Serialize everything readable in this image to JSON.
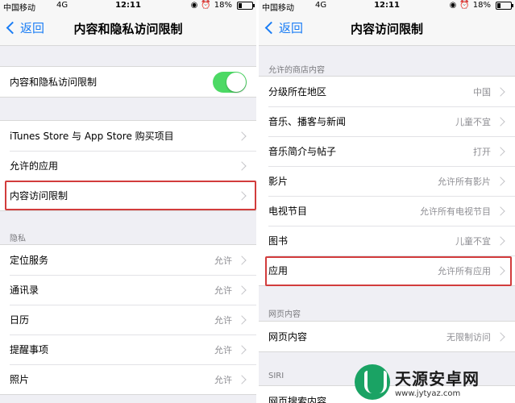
{
  "left": {
    "status": {
      "carrier": "中国移动",
      "network": "4G",
      "time": "12:11",
      "battery": "18%"
    },
    "nav": {
      "back": "返回",
      "title": "内容和隐私访问限制"
    },
    "toggle_row": {
      "label": "内容和隐私访问限制",
      "on": true
    },
    "group1": [
      {
        "label": "iTunes Store 与 App Store 购买项目",
        "value": ""
      },
      {
        "label": "允许的应用",
        "value": ""
      },
      {
        "label": "内容访问限制",
        "value": ""
      }
    ],
    "privacy_header": "隐私",
    "privacy": [
      {
        "label": "定位服务",
        "value": "允许"
      },
      {
        "label": "通讯录",
        "value": "允许"
      },
      {
        "label": "日历",
        "value": "允许"
      },
      {
        "label": "提醒事项",
        "value": "允许"
      },
      {
        "label": "照片",
        "value": "允许"
      }
    ]
  },
  "right": {
    "status": {
      "carrier": "中国移动",
      "network": "4G",
      "time": "12:11",
      "battery": "18%"
    },
    "nav": {
      "back": "返回",
      "title": "内容访问限制"
    },
    "store_header": "允许的商店内容",
    "store": [
      {
        "label": "分级所在地区",
        "value": "中国"
      },
      {
        "label": "音乐、播客与新闻",
        "value": "儿童不宜"
      },
      {
        "label": "音乐简介与帖子",
        "value": "打开"
      },
      {
        "label": "影片",
        "value": "允许所有影片"
      },
      {
        "label": "电视节目",
        "value": "允许所有电视节目"
      },
      {
        "label": "图书",
        "value": "儿童不宜"
      },
      {
        "label": "应用",
        "value": "允许所有应用"
      }
    ],
    "web_header": "网页内容",
    "web": [
      {
        "label": "网页内容",
        "value": "无限制访问"
      }
    ],
    "siri_header": "SIRI",
    "siri": [
      {
        "label": "网页搜索内容",
        "value": ""
      }
    ]
  },
  "watermark": {
    "name": "天源安卓网",
    "url": "www.jytyaz.com"
  },
  "colors": {
    "accent": "#1a7df5",
    "toggle_on": "#4cd964",
    "highlight": "#d23c3c"
  }
}
